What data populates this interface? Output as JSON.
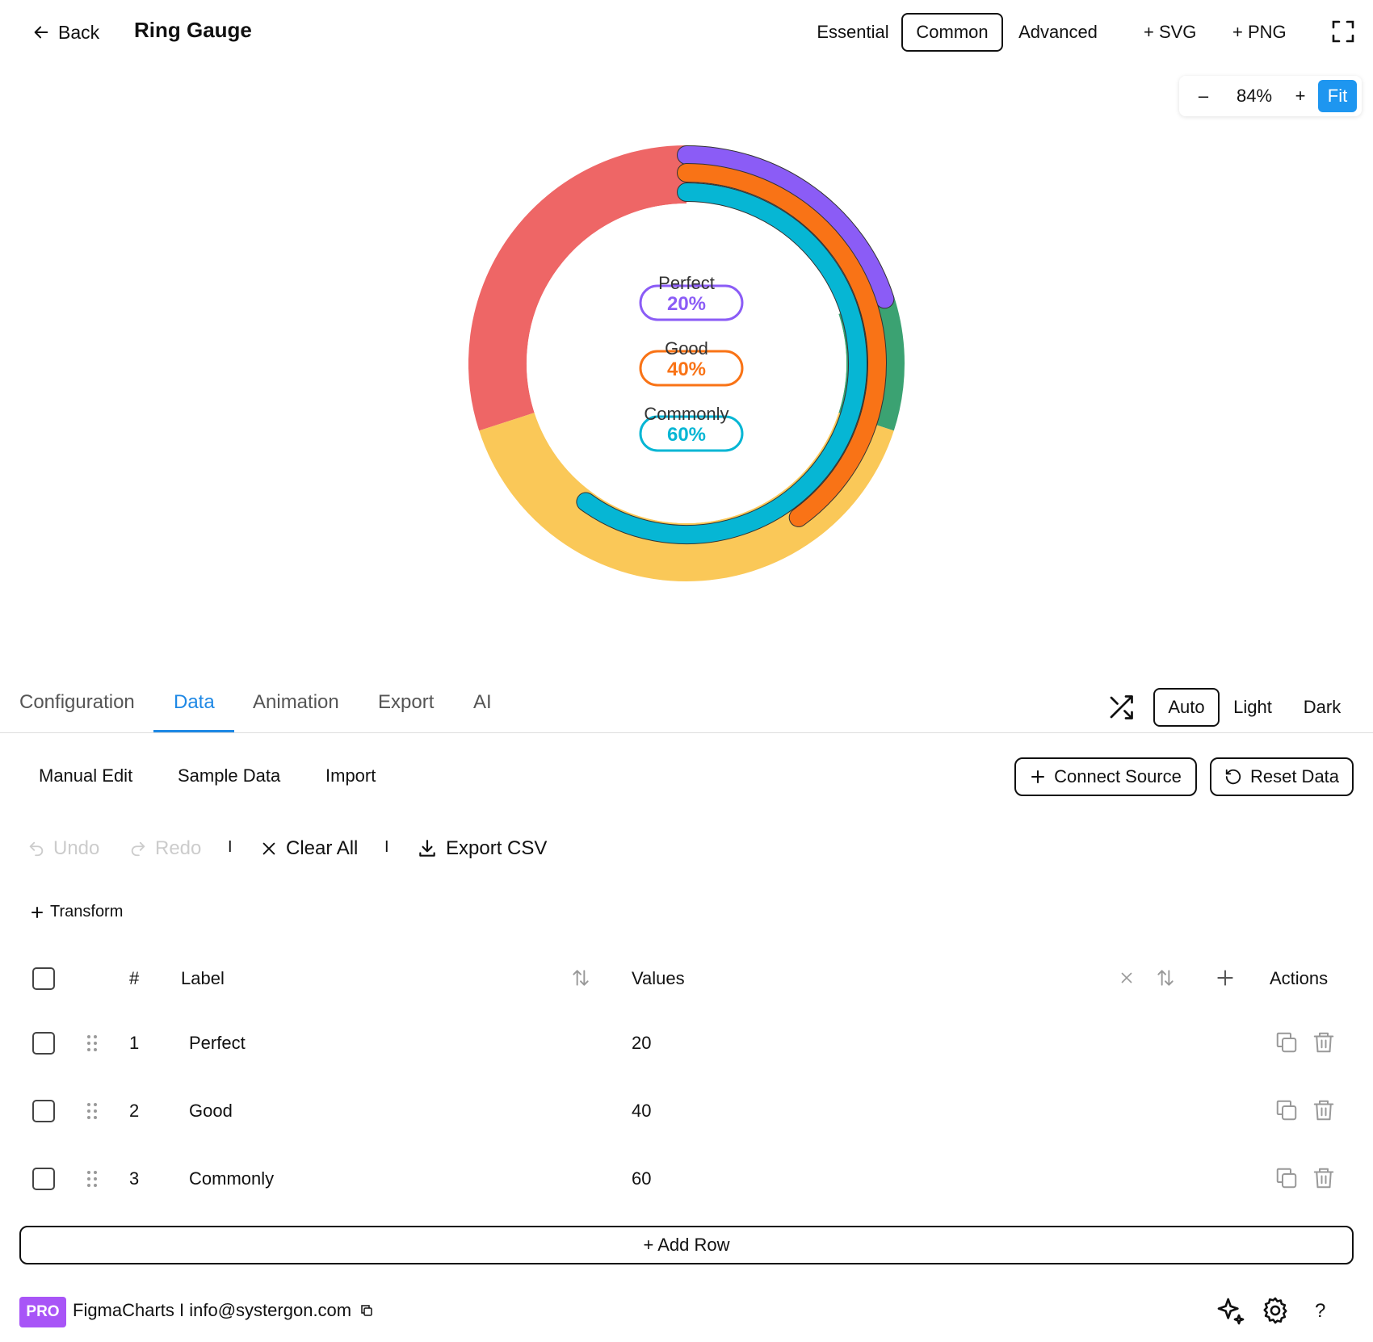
{
  "header": {
    "back_label": "Back",
    "title": "Ring Gauge",
    "modes": [
      "Essential",
      "Common",
      "Advanced"
    ],
    "selected_mode": "Common",
    "export_svg": "+ SVG",
    "export_png": "+ PNG"
  },
  "zoom": {
    "minus": "–",
    "level": "84%",
    "plus": "+",
    "fit": "Fit"
  },
  "tabs": [
    "Configuration",
    "Data",
    "Animation",
    "Export",
    "AI"
  ],
  "active_tab": "Data",
  "theme": {
    "options": [
      "Auto",
      "Light",
      "Dark"
    ],
    "selected": "Auto"
  },
  "data_panel": {
    "subtabs": [
      "Manual Edit",
      "Sample Data",
      "Import"
    ],
    "connect_source": "Connect Source",
    "reset_data": "Reset Data",
    "toolbar": {
      "undo": "Undo",
      "redo": "Redo",
      "separator": "I",
      "clear_all": "Clear All",
      "export_csv": "Export CSV"
    },
    "transform": "Transform",
    "columns": {
      "index": "#",
      "label": "Label",
      "values": "Values",
      "actions": "Actions"
    },
    "rows": [
      {
        "index": "1",
        "label": "Perfect",
        "value": "20"
      },
      {
        "index": "2",
        "label": "Good",
        "value": "40"
      },
      {
        "index": "3",
        "label": "Commonly",
        "value": "60"
      }
    ],
    "add_row": "+ Add Row"
  },
  "footer": {
    "badge": "PRO",
    "text": "FigmaCharts I info@systergon.com"
  },
  "chart_data": {
    "type": "ring-gauge",
    "background_bands": [
      {
        "color": "#ee6666"
      },
      {
        "color": "#3ba272"
      },
      {
        "color": "#fac858"
      }
    ],
    "series": [
      {
        "name": "Perfect",
        "value": 20,
        "max": 100,
        "color": "#8b5cf6"
      },
      {
        "name": "Good",
        "value": 40,
        "max": 100,
        "color": "#f97316"
      },
      {
        "name": "Commonly",
        "value": 60,
        "max": 100,
        "color": "#06b6d4"
      }
    ]
  },
  "colors": {
    "accent": "#1e88e5",
    "fit_button": "#1e96f0",
    "pro_badge": "#a855f7"
  }
}
